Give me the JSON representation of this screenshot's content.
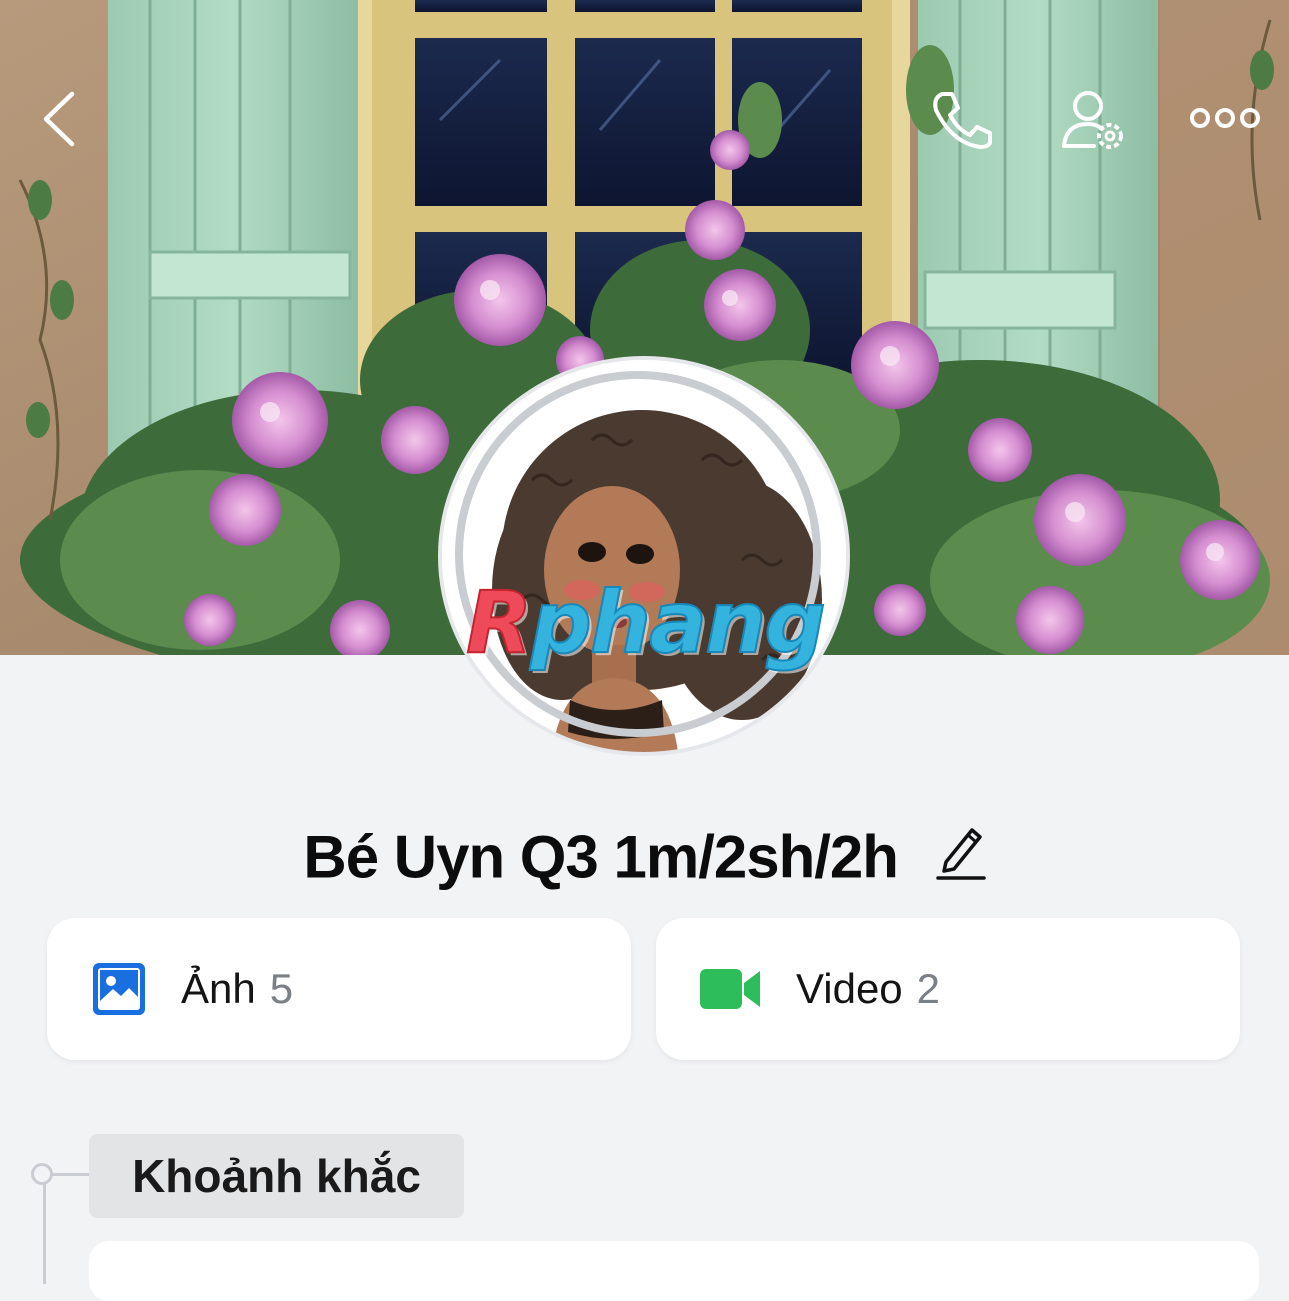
{
  "profile": {
    "name": "Bé Uyn Q3 1m/2sh/2h",
    "avatar_watermark": "Rphang"
  },
  "topbar": {
    "back_icon": "chevron-left-icon",
    "call_icon": "phone-icon",
    "settings_icon": "user-settings-icon",
    "more_icon": "more-horizontal-icon"
  },
  "media": {
    "photos": {
      "label": "Ảnh",
      "count": "5",
      "icon": "image-icon",
      "color": "#1a6fe0"
    },
    "video": {
      "label": "Video",
      "count": "2",
      "icon": "video-camera-icon",
      "color": "#2dbd5a"
    }
  },
  "moments": {
    "label": "Khoảnh khắc"
  },
  "colors": {
    "background": "#f2f3f5",
    "card": "#ffffff",
    "muted_text": "#7b7f86",
    "chip": "#e3e4e6"
  }
}
